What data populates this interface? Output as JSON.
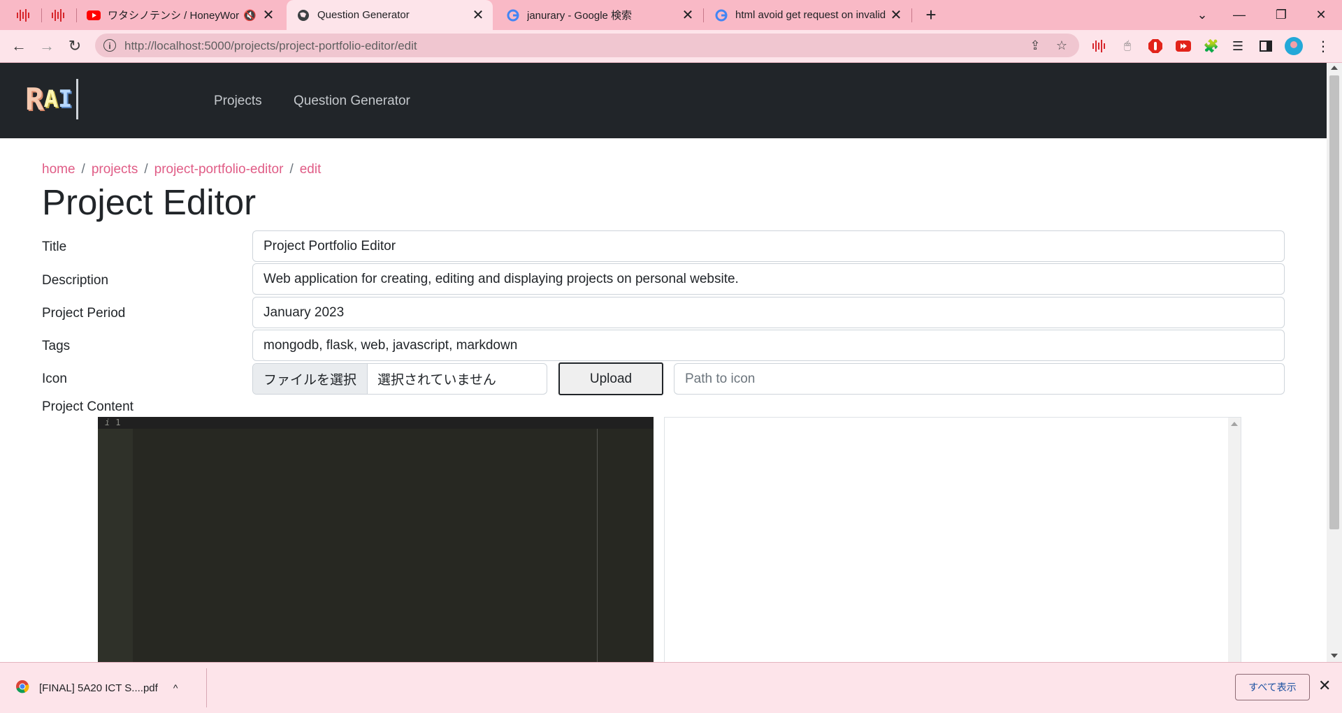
{
  "browser": {
    "tabs": [
      {
        "title": "ワタシノテンシ / HoneyWorks[C",
        "icon": "youtube-icon",
        "muted": true
      },
      {
        "title": "Question Generator",
        "icon": "globe-icon",
        "active": true
      },
      {
        "title": "janurary - Google 検索",
        "icon": "google-icon"
      },
      {
        "title": "html avoid get request on invalid",
        "icon": "google-icon"
      }
    ],
    "new_tab": "+",
    "window_controls": {
      "dropdown": "⌄",
      "minimize": "—",
      "restore": "❐",
      "close": "✕"
    },
    "nav": {
      "back": "←",
      "forward": "→",
      "reload": "↻"
    },
    "url": "http://localhost:5000/projects/project-portfolio-editor/edit",
    "accent_color": "#f9b9c6"
  },
  "site": {
    "logo": {
      "letters": [
        "R",
        "A",
        "I"
      ]
    },
    "nav_links": [
      "Projects",
      "Question Generator"
    ]
  },
  "breadcrumb": [
    "home",
    "projects",
    "project-portfolio-editor",
    "edit"
  ],
  "page_title": "Project Editor",
  "form": {
    "title": {
      "label": "Title",
      "value": "Project Portfolio Editor"
    },
    "description": {
      "label": "Description",
      "value": "Web application for creating, editing and displaying projects on personal website."
    },
    "period": {
      "label": "Project Period",
      "value": "January 2023"
    },
    "tags": {
      "label": "Tags",
      "value": "mongodb, flask, web, javascript, markdown"
    },
    "icon": {
      "label": "Icon",
      "choose_file": "ファイルを選択",
      "no_file": "選択されていません",
      "upload_button": "Upload",
      "path_placeholder": "Path to icon"
    },
    "content": {
      "label": "Project Content",
      "editor_line": "1",
      "editor_info": "i"
    }
  },
  "download_shelf": {
    "file": "[FINAL] 5A20 ICT S....pdf",
    "show_all": "すべて表示",
    "close": "✕"
  }
}
